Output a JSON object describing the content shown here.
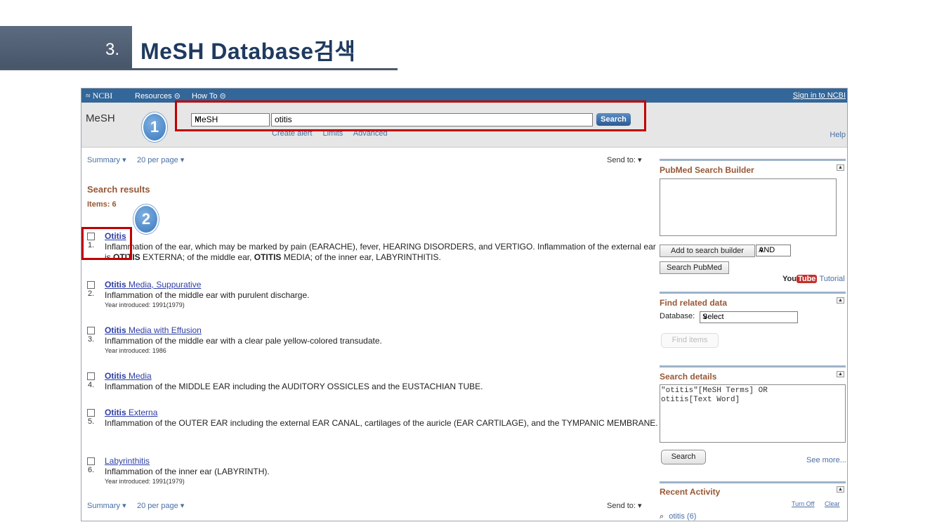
{
  "slide": {
    "number": "3.",
    "title": "MeSH Database검색"
  },
  "ncbi": {
    "logo": "NCBI",
    "menu": [
      "Resources",
      "How To"
    ],
    "sign_in": "Sign in to NCBI"
  },
  "search": {
    "db_label": "MeSH",
    "db_selected": "MeSH",
    "query": "otitis",
    "button": "Search",
    "links": [
      "Create alert",
      "Limits",
      "Advanced"
    ],
    "help": "Help"
  },
  "badges": {
    "one": "1",
    "two": "2"
  },
  "controls": {
    "summary": "Summary",
    "per_page": "20 per page",
    "send_to": "Send to:"
  },
  "results": {
    "heading": "Search results",
    "items_label": "Items: 6",
    "list": [
      {
        "num": "1.",
        "title_bold": "Otitis",
        "title_rest": "",
        "desc_html": true,
        "year": ""
      },
      {
        "num": "2.",
        "title_bold": "Otitis",
        "title_rest": " Media, Suppurative",
        "desc": "Inflammation of the middle ear with purulent discharge.",
        "year": "Year introduced: 1991(1979)"
      },
      {
        "num": "3.",
        "title_bold": "Otitis",
        "title_rest": " Media with Effusion",
        "desc": "Inflammation of the middle ear with a clear pale yellow-colored transudate.",
        "year": "Year introduced: 1986"
      },
      {
        "num": "4.",
        "title_bold": "Otitis",
        "title_rest": " Media",
        "desc": "Inflammation of the MIDDLE EAR including the AUDITORY OSSICLES and the EUSTACHIAN TUBE.",
        "year": ""
      },
      {
        "num": "5.",
        "title_bold": "Otitis",
        "title_rest": " Externa",
        "desc": "Inflammation of the OUTER EAR including the external EAR CANAL, cartilages of the auricle (EAR CARTILAGE), and the TYMPANIC MEMBRANE.",
        "year": ""
      },
      {
        "num": "6.",
        "title_bold": "",
        "title_rest": "Labyrinthitis",
        "desc": "Inflammation of the inner ear (LABYRINTH).",
        "year": "Year introduced: 1991(1979)"
      }
    ],
    "r1_desc_a": "Inflammation of the ear, which may be marked by pain (EARACHE), fever, HEARING DISORDERS, and VERTIGO. Inflammation of the external ear is ",
    "r1_desc_b": "OTITIS",
    "r1_desc_c": " EXTERNA; of the middle ear, ",
    "r1_desc_d": "OTITIS",
    "r1_desc_e": " MEDIA; of the inner ear, LABYRINTHITIS."
  },
  "sidebar": {
    "builder": {
      "title": "PubMed Search Builder",
      "add_button": "Add to search builder",
      "operator": "AND",
      "search_button": "Search PubMed",
      "yt_you": "You",
      "yt_tube": "Tube",
      "tutorial": "Tutorial"
    },
    "related": {
      "title": "Find related data",
      "db_label": "Database:",
      "db_selected": "Select",
      "find_button": "Find items"
    },
    "details": {
      "title": "Search details",
      "query_line1": "\"otitis\"[MeSH Terms] OR",
      "query_line2": "otitis[Text Word]",
      "search_button": "Search",
      "see_more": "See more..."
    },
    "recent": {
      "title": "Recent Activity",
      "turn_off": "Turn Off",
      "clear": "Clear",
      "item": "otitis (6)"
    }
  }
}
